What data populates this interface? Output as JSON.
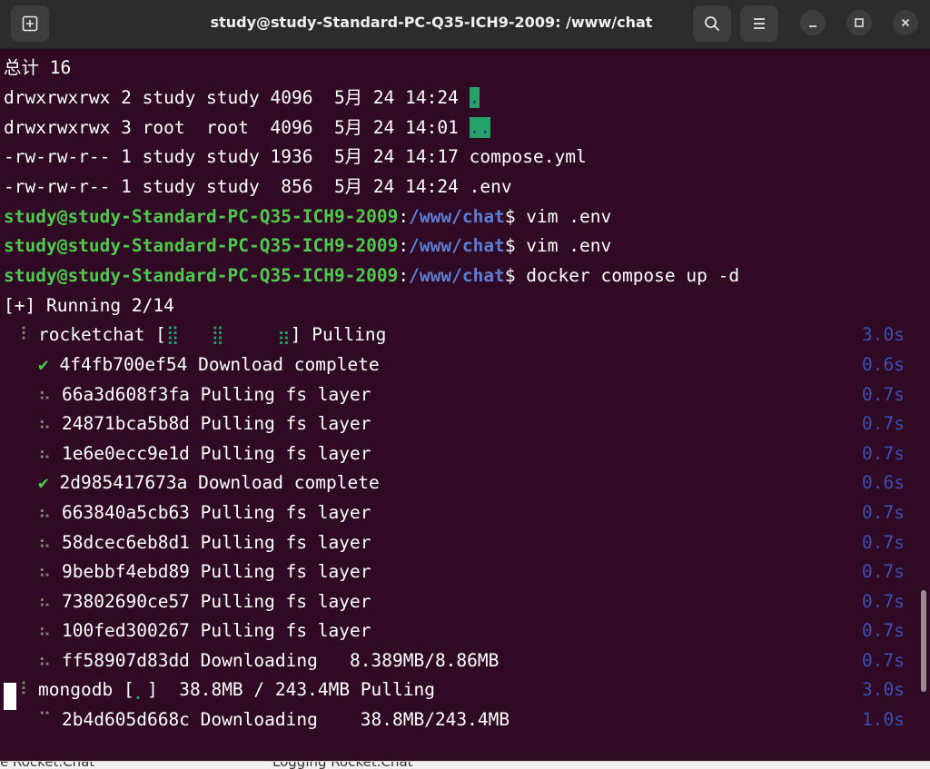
{
  "window": {
    "title": "study@study-Standard-PC-Q35-ICH9-2009: /www/chat",
    "icons": {
      "new_tab": "new-tab-icon",
      "search": "search-icon",
      "menu": "hamburger-menu-icon",
      "minimize": "minimize-icon",
      "maximize": "maximize-icon",
      "close": "close-icon"
    },
    "colors": {
      "background": "#300a24",
      "prompt_user": "#4ec94e",
      "prompt_path": "#5c7fd6",
      "time": "#3b4fb0",
      "highlight": "#26a269"
    }
  },
  "terminal": {
    "total": "总计 16",
    "listing": [
      {
        "text": "drwxrwxrwx 2 study study 4096  5月 24 14:24 ",
        "name": "."
      },
      {
        "text": "drwxrwxrwx 3 root  root  4096  5月 24 14:01 ",
        "name": ".."
      },
      {
        "text": "-rw-rw-r-- 1 study study 1936  5月 24 14:17 ",
        "name": "compose.yml"
      },
      {
        "text": "-rw-rw-r-- 1 study study  856  5月 24 14:24 ",
        "name": ".env"
      }
    ],
    "prompt_user": "study@study-Standard-PC-Q35-ICH9-2009",
    "prompt_sep": ":",
    "prompt_path": "/www/chat",
    "prompt_dollar": "$ ",
    "commands": [
      "vim .env",
      "vim .env",
      "docker compose up -d"
    ],
    "running": "[+] Running 2/14",
    "rocketchat": {
      "spinner": "⠸",
      "label": "rocketchat [",
      "bar": "⣿   ⣿     ⣶",
      "suffix": "] Pulling",
      "time": "3.0s"
    },
    "layers": [
      {
        "icon": "✔",
        "status": "done",
        "text": "4f4fb700ef54 Download complete",
        "time": "0.6s"
      },
      {
        "icon": "⠦",
        "status": "wait",
        "text": "66a3d608f3fa Pulling fs layer",
        "time": "0.7s"
      },
      {
        "icon": "⠦",
        "status": "wait",
        "text": "24871bca5b8d Pulling fs layer",
        "time": "0.7s"
      },
      {
        "icon": "⠦",
        "status": "wait",
        "text": "1e6e0ecc9e1d Pulling fs layer",
        "time": "0.7s"
      },
      {
        "icon": "✔",
        "status": "done",
        "text": "2d985417673a Download complete",
        "time": "0.6s"
      },
      {
        "icon": "⠦",
        "status": "wait",
        "text": "663840a5cb63 Pulling fs layer",
        "time": "0.7s"
      },
      {
        "icon": "⠦",
        "status": "wait",
        "text": "58dcec6eb8d1 Pulling fs layer",
        "time": "0.7s"
      },
      {
        "icon": "⠦",
        "status": "wait",
        "text": "9bebbf4ebd89 Pulling fs layer",
        "time": "0.7s"
      },
      {
        "icon": "⠦",
        "status": "wait",
        "text": "73802690ce57 Pulling fs layer",
        "time": "0.7s"
      },
      {
        "icon": "⠦",
        "status": "wait",
        "text": "100fed300267 Pulling fs layer",
        "time": "0.7s"
      },
      {
        "icon": "⠦",
        "status": "wait",
        "text": "ff58907d83dd Downloading   8.389MB/8.86MB",
        "time": "0.7s"
      }
    ],
    "mongodb": {
      "spinner": "⠸",
      "label": "mongodb [",
      "bar": "⡀",
      "suffix": "]  38.8MB / 243.4MB Pulling",
      "time": "3.0s"
    },
    "mongo_layer": {
      "icon": "⠉",
      "text": "2b4d605d668c Downloading    38.8MB/243.4MB",
      "time": "1.0s"
    }
  },
  "background_strip": {
    "left": "e Rocket.Chat",
    "middle": "Logging Rocket.Chat"
  }
}
